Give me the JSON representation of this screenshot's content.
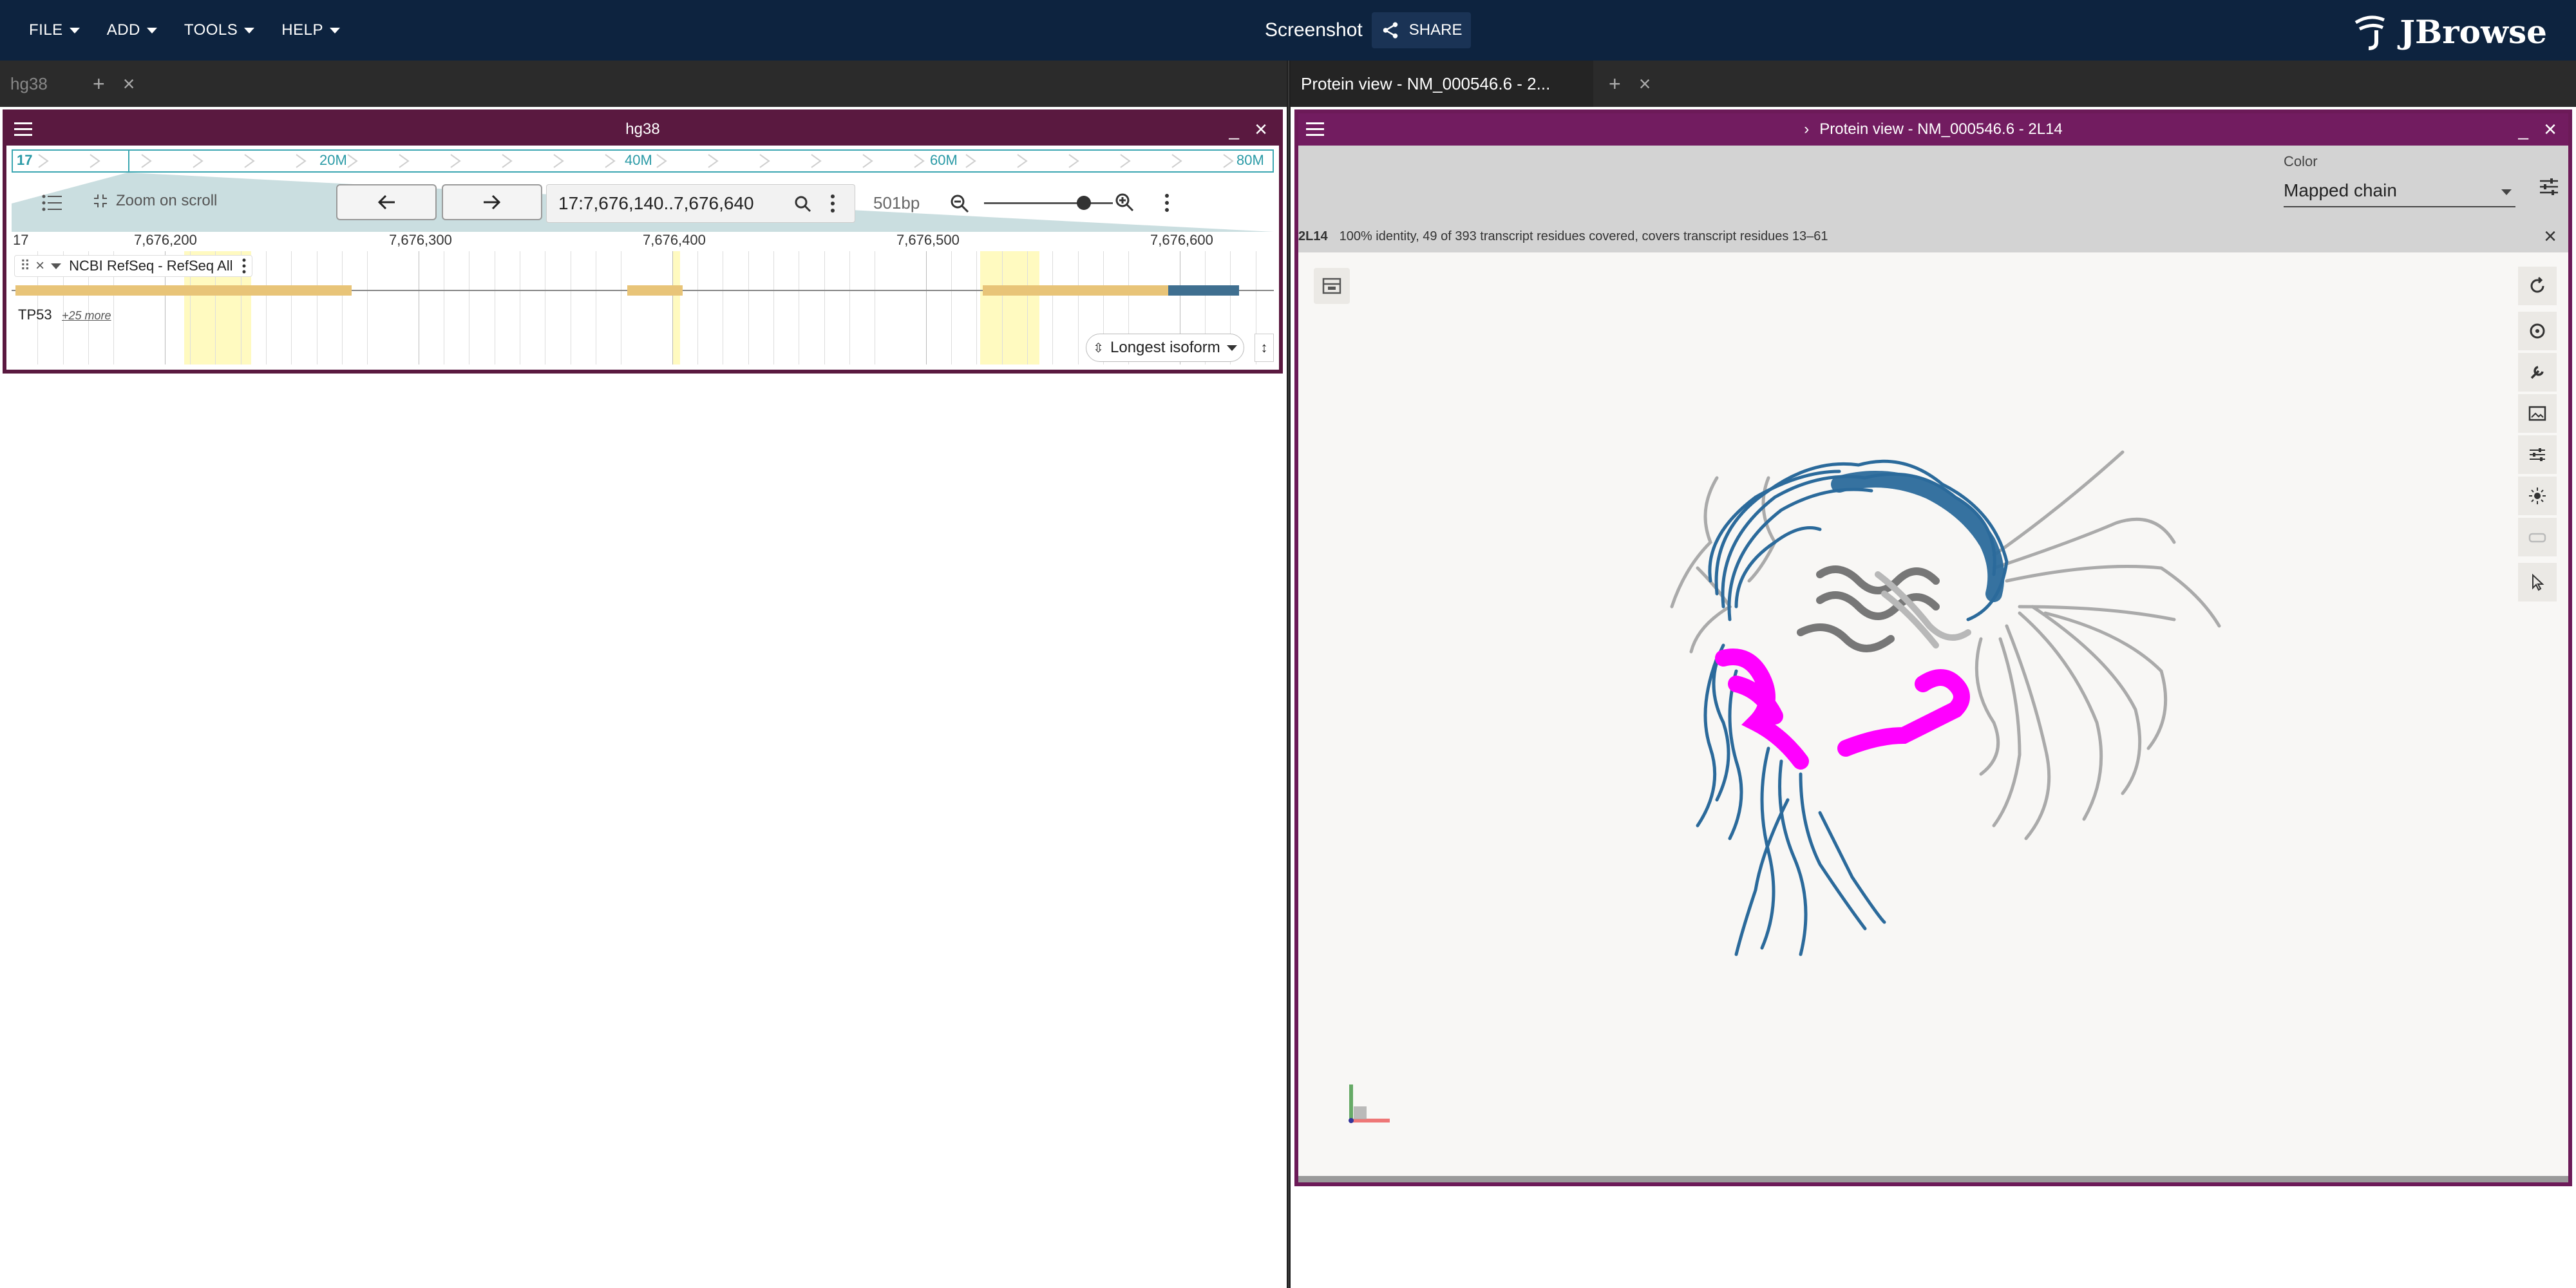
{
  "menu": {
    "file": "FILE",
    "add": "ADD",
    "tools": "TOOLS",
    "help": "HELP"
  },
  "header": {
    "session_title": "Screenshot",
    "share_label": "SHARE",
    "brand": "JBrowse"
  },
  "left_tabs": {
    "active": "hg38"
  },
  "right_tabs": {
    "active": "Protein view - NM_000546.6 - 2..."
  },
  "linear_view": {
    "title": "hg38",
    "overview": {
      "chrom": "17",
      "labels": [
        "20M",
        "40M",
        "60M",
        "80M"
      ]
    },
    "zoom_on_scroll": "Zoom on scroll",
    "location": "17:7,676,140..7,676,640",
    "bp": "501bp",
    "ruler": {
      "chrom": "17",
      "ticks": [
        "7,676,200",
        "7,676,300",
        "7,676,400",
        "7,676,500",
        "7,676,600"
      ]
    },
    "track_label": "NCBI RefSeq - RefSeq All",
    "gene_name": "TP53",
    "more": "+25 more",
    "isoform_button": "Longest isoform"
  },
  "protein_view": {
    "title": "Protein view - NM_000546.6 - 2L14",
    "color_label": "Color",
    "color_value": "Mapped chain",
    "alignment_id": "2L14",
    "alignment_text": "100% identity, 49 of 393 transcript residues covered, covers transcript residues 13–61"
  },
  "colors": {
    "appbar": "#0d233f",
    "left_panel_header": "#5a1940",
    "right_panel_header": "#721c60",
    "chain_blue": "#2b6a9b",
    "chain_gray": "#9a9a9a",
    "highlight_magenta": "#ff00ff"
  },
  "icons": [
    "hamburger-menu-icon",
    "share-icon",
    "arrow-left-icon",
    "arrow-right-icon",
    "search-icon",
    "zoom-in-icon",
    "zoom-out-icon",
    "more-vert-icon",
    "rotate-icon",
    "settings-icon",
    "wrench-icon",
    "screenshot-icon",
    "tune-icon",
    "light-icon",
    "select-pointer-icon"
  ]
}
